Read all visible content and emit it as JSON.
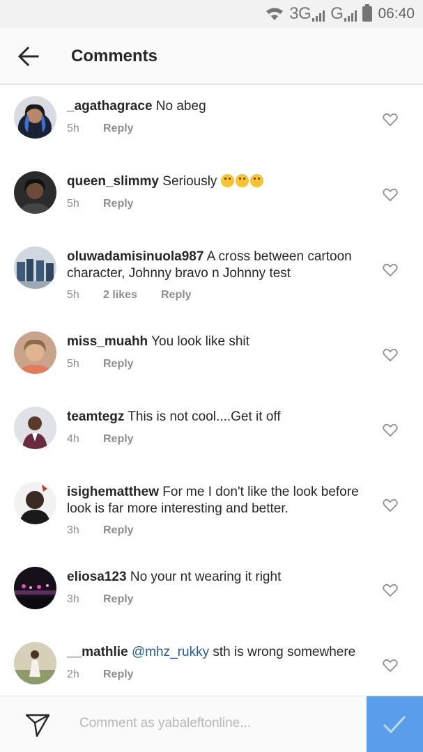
{
  "status_bar": {
    "network_1": "3G",
    "network_2": "G",
    "time": "06:40"
  },
  "app_bar": {
    "title": "Comments",
    "back_icon": "arrow-left-icon"
  },
  "comments": [
    {
      "username": "_agathagrace",
      "text": "No abeg",
      "time": "5h",
      "likes": "",
      "reply": "Reply"
    },
    {
      "username": "queen_slimmy",
      "text": "Seriously",
      "emoji_count": 3,
      "time": "5h",
      "likes": "",
      "reply": "Reply"
    },
    {
      "username": "oluwadamisinuola987",
      "text": "A cross between cartoon character, Johnny bravo n Johnny test",
      "time": "5h",
      "likes": "2 likes",
      "reply": "Reply"
    },
    {
      "username": "miss_muahh",
      "text": "You look like shit",
      "time": "5h",
      "likes": "",
      "reply": "Reply"
    },
    {
      "username": "teamtegz",
      "text": "This is not cool....Get it off",
      "time": "4h",
      "likes": "",
      "reply": "Reply"
    },
    {
      "username": "isighematthew",
      "text": "For me I don't like the look before look is far more interesting and better.",
      "time": "3h",
      "likes": "",
      "reply": "Reply"
    },
    {
      "username": "eliosa123",
      "text": "No your nt wearing it right",
      "time": "3h",
      "likes": "",
      "reply": "Reply"
    },
    {
      "username": "__mathlie",
      "mention": "@mhz_rukky",
      "text": "sth is wrong somewhere",
      "time": "2h",
      "likes": "",
      "reply": "Reply"
    }
  ],
  "composer": {
    "placeholder": "Comment as yabaleftonline...",
    "send_icon": "paper-plane-icon",
    "post_icon": "checkmark-icon"
  },
  "colors": {
    "accent": "#3d8ee6",
    "mention": "#1f5c99",
    "meta": "#8e8e8e"
  }
}
